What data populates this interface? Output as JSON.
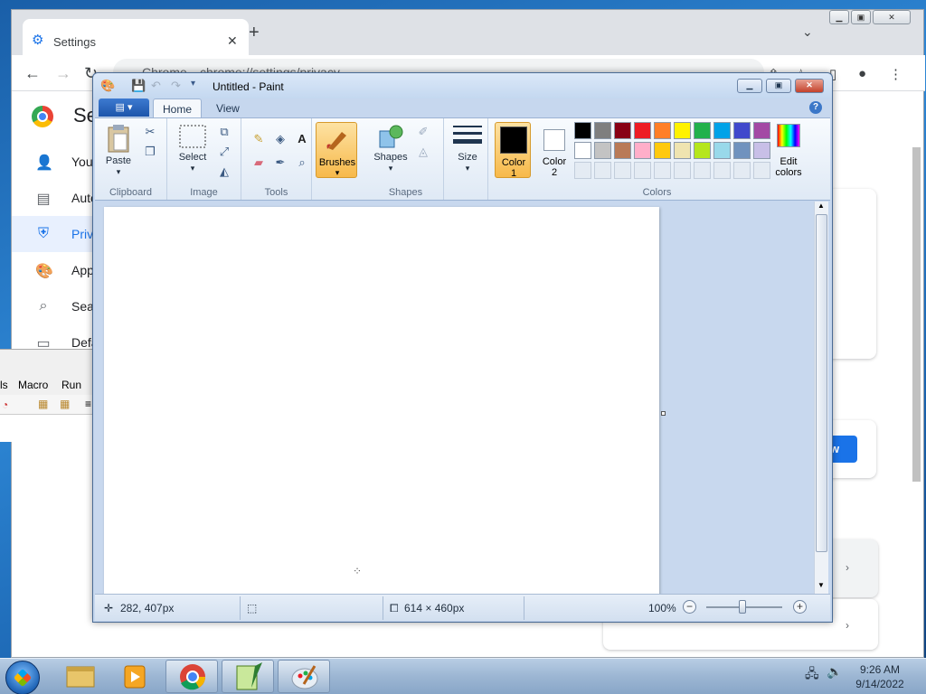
{
  "chrome": {
    "tab_title": "Settings",
    "site_label": "Chrome",
    "url": "chrome://settings/privacy",
    "settings_title": "Se",
    "sidebar": [
      {
        "label": "You",
        "icon": "person-icon",
        "active": false
      },
      {
        "label": "Auto",
        "icon": "clipboard-icon",
        "active": false
      },
      {
        "label": "Priv",
        "icon": "shield-icon",
        "active": true
      },
      {
        "label": "App",
        "icon": "palette-icon",
        "active": false
      },
      {
        "label": "Sea",
        "icon": "search-icon",
        "active": false
      },
      {
        "label": "Defa",
        "icon": "browser-icon",
        "active": false
      }
    ],
    "blue_button_text": "w"
  },
  "notepadpp": {
    "menu": [
      "ls",
      "Macro",
      "Run"
    ]
  },
  "paint": {
    "title": "Untitled - Paint",
    "file_menu_icon": "paint-menu-icon",
    "tabs": [
      "Home",
      "View"
    ],
    "active_tab": "Home",
    "groups": {
      "clipboard": "Clipboard",
      "image": "Image",
      "tools": "Tools",
      "shapes": "Shapes",
      "colors": "Colors"
    },
    "buttons": {
      "paste": "Paste",
      "select": "Select",
      "brushes": "Brushes",
      "shapes": "Shapes",
      "size": "Size",
      "color1_line1": "Color",
      "color1_line2": "1",
      "color2_line1": "Color",
      "color2_line2": "2",
      "edit_colors_line1": "Edit",
      "edit_colors_line2": "colors"
    },
    "palette_row1": [
      "#000000",
      "#7f7f7f",
      "#880015",
      "#ed1c24",
      "#ff7f27",
      "#fff200",
      "#22b14c",
      "#00a2e8",
      "#3f48cc",
      "#a349a4"
    ],
    "palette_row2": [
      "#ffffff",
      "#c3c3c3",
      "#b97a57",
      "#ffaec9",
      "#ffc90e",
      "#efe4b0",
      "#b5e61d",
      "#99d9ea",
      "#7092be",
      "#c8bfe7"
    ],
    "color1": "#000000",
    "color2": "#ffffff",
    "status": {
      "cursor_pos": "282, 407px",
      "canvas_size": "614 × 460px",
      "zoom": "100%"
    }
  },
  "taskbar": {
    "apps": [
      "file-explorer-icon",
      "media-player-icon",
      "chrome-icon",
      "notepadpp-icon",
      "paint-icon"
    ],
    "time": "9:26 AM",
    "date": "9/14/2022"
  }
}
